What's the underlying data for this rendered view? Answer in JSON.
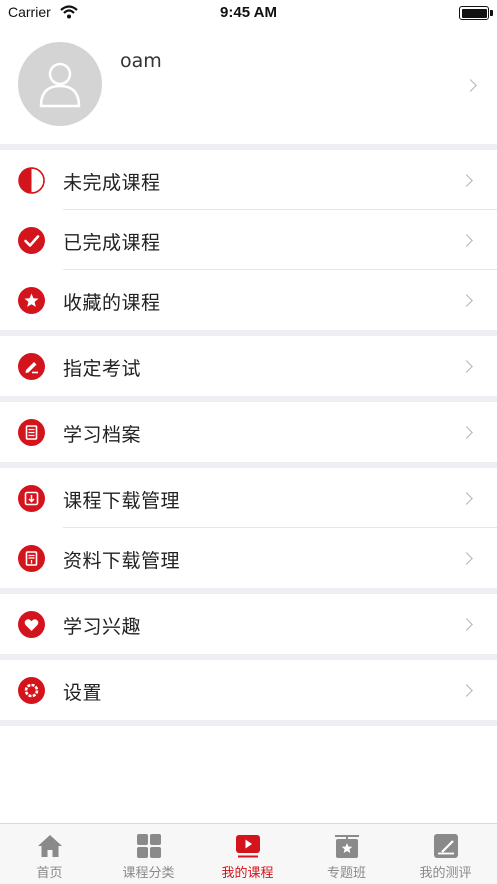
{
  "status_bar": {
    "carrier": "Carrier",
    "time": "9:45 AM"
  },
  "profile": {
    "username": "oam"
  },
  "menu": [
    {
      "label": "未完成课程",
      "icon": "half-circle-icon"
    },
    {
      "label": "已完成课程",
      "icon": "check-icon"
    },
    {
      "label": "收藏的课程",
      "icon": "star-icon"
    },
    {
      "label": "指定考试",
      "icon": "pencil-icon"
    },
    {
      "label": "学习档案",
      "icon": "document-icon"
    },
    {
      "label": "课程下载管理",
      "icon": "download-icon"
    },
    {
      "label": "资料下载管理",
      "icon": "file-download-icon"
    },
    {
      "label": "学习兴趣",
      "icon": "heart-icon"
    },
    {
      "label": "设置",
      "icon": "gear-icon"
    }
  ],
  "tabbar": {
    "active": "我的课程",
    "tabs": [
      {
        "label": "首页",
        "icon": "home-icon"
      },
      {
        "label": "课程分类",
        "icon": "grid-icon"
      },
      {
        "label": "我的课程",
        "icon": "play-icon"
      },
      {
        "label": "专题班",
        "icon": "board-star-icon"
      },
      {
        "label": "我的测评",
        "icon": "edit-icon"
      }
    ]
  },
  "colors": {
    "accent": "#d4141c",
    "section_gap": "#eeeef4",
    "tab_inactive": "#8a8a8a"
  }
}
